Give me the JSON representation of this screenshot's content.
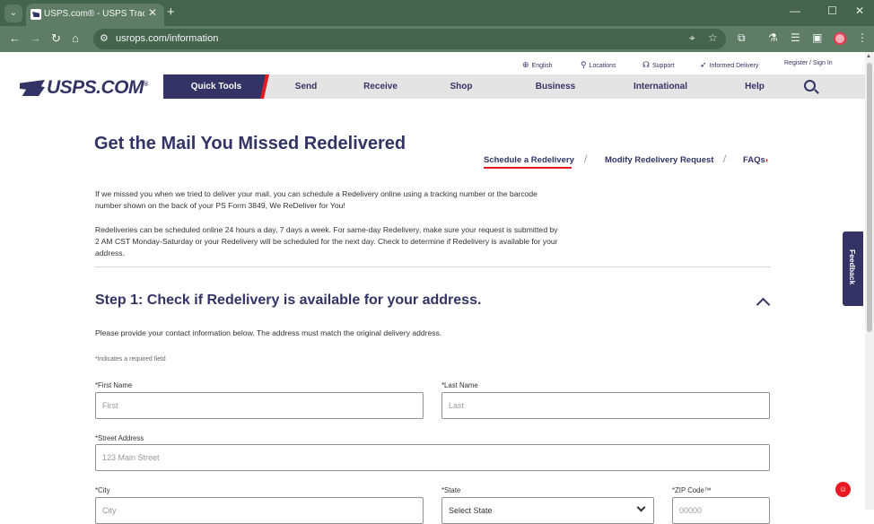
{
  "browser": {
    "tab_title": "USPS.com® - USPS Tracking®",
    "tab_close": "✕",
    "new_tab": "+",
    "tab_menu": "⌄",
    "url": "usrops.com/information",
    "window": {
      "minimize": "—",
      "maximize": "☐",
      "close": "✕"
    },
    "nav": {
      "back": "←",
      "forward": "→",
      "reload": "↻",
      "home": "⌂"
    }
  },
  "utility_nav": {
    "english": "English",
    "locations": "Locations",
    "support": "Support",
    "informed_delivery": "Informed Delivery",
    "register": "Register / Sign In"
  },
  "logo": {
    "text": "USPS.COM",
    "mark": "®"
  },
  "main_nav": {
    "quick_tools": "Quick Tools",
    "items": [
      "Send",
      "Receive",
      "Shop",
      "Business",
      "International",
      "Help"
    ]
  },
  "page": {
    "title": "Get the Mail You Missed Redelivered",
    "subnav": {
      "schedule": "Schedule a Redelivery",
      "modify": "Modify Redelivery Request",
      "faqs": "FAQs",
      "separator": "/"
    },
    "intro_lines": [
      "If we missed you when we tried to deliver your mail, you can schedule a Redelivery online using a tracking number or the barcode",
      "number shown on the back of your PS Form 3849, We ReDeliver for You!",
      "Redeliveries can be scheduled online 24 hours a day, 7 days a week. For same-day Redelivery, make sure your request is submitted by",
      "2 AM CST Monday-Saturday or your Redelivery will be scheduled for the next day. Check to determine if Redelivery is available for your",
      "address."
    ],
    "step": {
      "prefix": "Step 1: ",
      "title": "Check if Redelivery is available for your address."
    },
    "helper_text": "Please provide your contact information below. The address must match the original delivery address.",
    "required_note": "*indicates a required field"
  },
  "form": {
    "first_name": {
      "label": "*First Name",
      "placeholder": "First"
    },
    "last_name": {
      "label": "*Last Name",
      "placeholder": "Last"
    },
    "street": {
      "label": "*Street Address",
      "placeholder": "123 Main Street"
    },
    "city": {
      "label": "*City",
      "placeholder": "City"
    },
    "state": {
      "label": "*State",
      "value": "Select State"
    },
    "zip": {
      "label": "*ZIP Code™",
      "placeholder": "00000"
    }
  },
  "feedback": "Feedback",
  "colors": {
    "brand_navy": "#333366",
    "brand_red": "#e71921",
    "chrome_green": "#45644d"
  }
}
